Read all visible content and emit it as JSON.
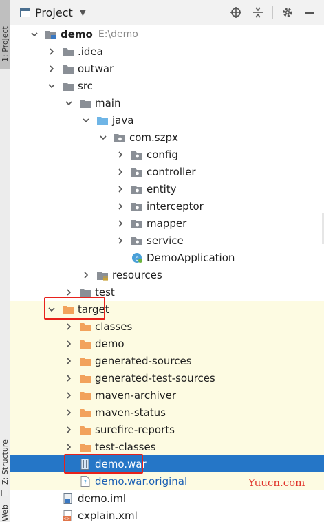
{
  "sidebar_tabs": {
    "project": "1: Project",
    "structure": "Z: Structure",
    "web": "Web"
  },
  "header": {
    "title": "Project",
    "icons": [
      "locate-icon",
      "collapse-icon",
      "gear-icon",
      "hide-icon"
    ]
  },
  "tree": [
    {
      "label": "demo",
      "hint": "E:\\demo",
      "icon": "module-folder-icon",
      "bold": true
    },
    {
      "label": ".idea",
      "icon": "folder-icon"
    },
    {
      "label": "outwar",
      "icon": "folder-icon"
    },
    {
      "label": "src",
      "icon": "folder-icon"
    },
    {
      "label": "main",
      "icon": "folder-icon"
    },
    {
      "label": "java",
      "icon": "source-folder-icon"
    },
    {
      "label": "com.szpx",
      "icon": "package-icon"
    },
    {
      "label": "config",
      "icon": "package-icon"
    },
    {
      "label": "controller",
      "icon": "package-icon"
    },
    {
      "label": "entity",
      "icon": "package-icon"
    },
    {
      "label": "interceptor",
      "icon": "package-icon"
    },
    {
      "label": "mapper",
      "icon": "package-icon"
    },
    {
      "label": "service",
      "icon": "package-icon"
    },
    {
      "label": "DemoApplication",
      "icon": "spring-class-icon"
    },
    {
      "label": "resources",
      "icon": "resources-folder-icon"
    },
    {
      "label": "test",
      "icon": "folder-icon"
    },
    {
      "label": "target",
      "icon": "excluded-folder-icon"
    },
    {
      "label": "classes",
      "icon": "excluded-folder-icon"
    },
    {
      "label": "demo",
      "icon": "excluded-folder-icon"
    },
    {
      "label": "generated-sources",
      "icon": "excluded-folder-icon"
    },
    {
      "label": "generated-test-sources",
      "icon": "excluded-folder-icon"
    },
    {
      "label": "maven-archiver",
      "icon": "excluded-folder-icon"
    },
    {
      "label": "maven-status",
      "icon": "excluded-folder-icon"
    },
    {
      "label": "surefire-reports",
      "icon": "excluded-folder-icon"
    },
    {
      "label": "test-classes",
      "icon": "excluded-folder-icon"
    },
    {
      "label": "demo.war",
      "icon": "archive-icon"
    },
    {
      "label": "demo.war.original",
      "icon": "file-icon"
    },
    {
      "label": "demo.iml",
      "icon": "iml-file-icon"
    },
    {
      "label": "explain.xml",
      "icon": "xml-file-icon"
    }
  ],
  "watermark": "Yuucn.com",
  "colors": {
    "selection": "#2576c7",
    "excluded_highlight": "#fdfbe2",
    "folder_gray": "#8a8f96",
    "folder_orange": "#f2a25c",
    "source_blue": "#6fb5e6",
    "annotation_red": "#e8221c"
  }
}
